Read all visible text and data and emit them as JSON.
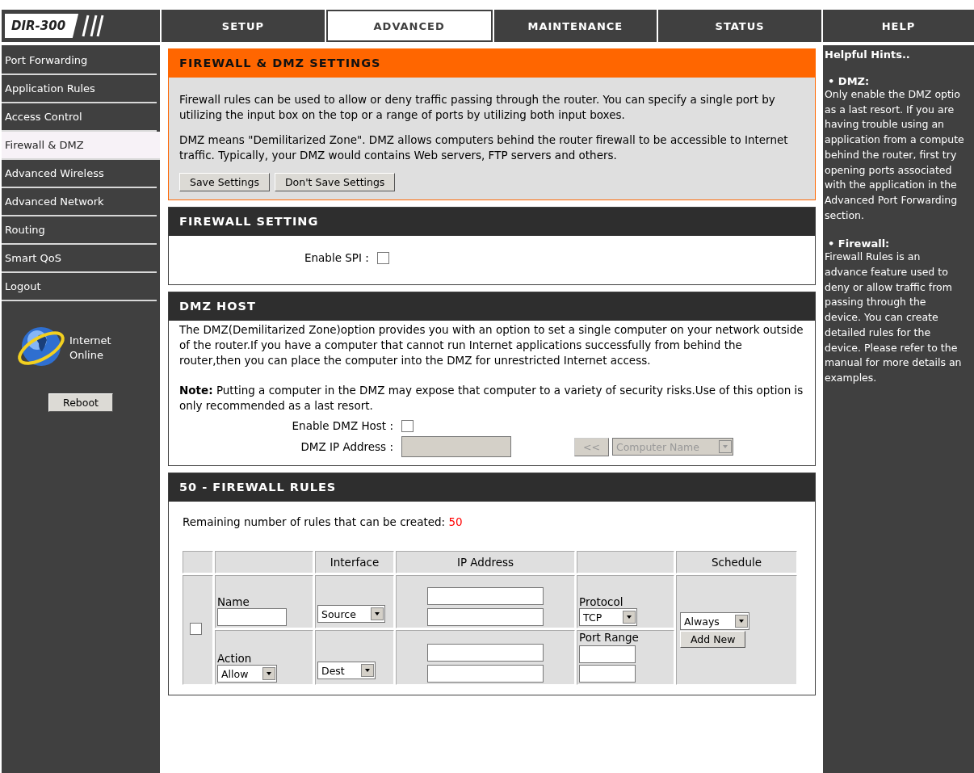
{
  "logo": {
    "text": "DIR-300"
  },
  "tabs": [
    {
      "label": "SETUP",
      "selected": false
    },
    {
      "label": "ADVANCED",
      "selected": true
    },
    {
      "label": "MAINTENANCE",
      "selected": false
    },
    {
      "label": "STATUS",
      "selected": false
    }
  ],
  "help_tab": "HELP",
  "sidebar": {
    "items": [
      {
        "label": "Port Forwarding",
        "selected": false
      },
      {
        "label": "Application Rules",
        "selected": false
      },
      {
        "label": "Access Control",
        "selected": false
      },
      {
        "label": "Firewall & DMZ",
        "selected": true
      },
      {
        "label": "Advanced Wireless",
        "selected": false
      },
      {
        "label": "Advanced Network",
        "selected": false
      },
      {
        "label": "Routing",
        "selected": false
      },
      {
        "label": "Smart QoS",
        "selected": false
      },
      {
        "label": "Logout",
        "selected": false
      }
    ],
    "status": "Internet Online",
    "reboot_button": "Reboot"
  },
  "intro": {
    "title": "FIREWALL & DMZ SETTINGS",
    "paragraphs": [
      "Firewall rules can be used to allow or deny traffic passing through the router. You can specify a single port by utilizing the input box on the top or a range of ports by utilizing both input boxes.",
      "DMZ means \"Demilitarized Zone\". DMZ allows computers behind the router firewall to be accessible to Internet traffic. Typically, your DMZ would contains Web servers, FTP servers and others."
    ],
    "buttons": [
      "Save Settings",
      "Don't Save Settings"
    ]
  },
  "firewall_setting": {
    "title": "FIREWALL SETTING",
    "enable_spi": {
      "label": "Enable SPI :",
      "checked": false
    }
  },
  "dmz_host": {
    "title": "DMZ HOST",
    "description": "The DMZ(Demilitarized Zone)option provides you with an option to set a single computer on your network outside of the router.If you have a computer that cannot run Internet applications successfully from behind the router,then you can place the computer into the DMZ for unrestricted Internet access.",
    "note": "**Note:** Putting a computer in the DMZ may expose that computer to a variety of security risks.Use of this option is only recommended as a last resort.",
    "enable": {
      "label": "Enable DMZ Host :",
      "checked": false
    },
    "ip_address": {
      "label": "DMZ IP Address :",
      "disabled": true
    },
    "copy_button": {
      "label": "<<",
      "disabled": true
    },
    "computer_select": {
      "value": "Computer Name",
      "disabled": true
    }
  },
  "rules": {
    "title": "50 - FIREWALL RULES",
    "remaining_label": "Remaining number of rules that can be created:",
    "remaining_count": "50",
    "columns": [
      "Interface",
      "IP Address",
      "Schedule"
    ],
    "row": {
      "checked": false,
      "name_label": "Name",
      "action_label": "Action",
      "action_value": "Allow",
      "source_value": "Source",
      "dest_value": "Dest",
      "protocol_label": "Protocol",
      "protocol_value": "TCP",
      "port_range_label": "Port Range",
      "schedule_value": "Always",
      "add_button": "Add New"
    }
  },
  "help": {
    "title": "Helpful Hints..",
    "sections": [
      {
        "heading": "• DMZ:",
        "lines": [
          "Only enable the DMZ optio",
          "as a last resort. If you are",
          "having trouble using an",
          "application from a compute",
          "behind the router, first try",
          "opening ports associated",
          "with the application in the",
          "Advanced Port Forwarding",
          "section."
        ]
      },
      {
        "heading": "• Firewall:",
        "lines": [
          "Firewall Rules is an",
          "advance feature used to",
          "deny or allow traffic from",
          "passing through the",
          "device. You can create",
          "detailed rules for the",
          "device. Please refer to the",
          "manual for more details an",
          "examples."
        ]
      }
    ]
  }
}
